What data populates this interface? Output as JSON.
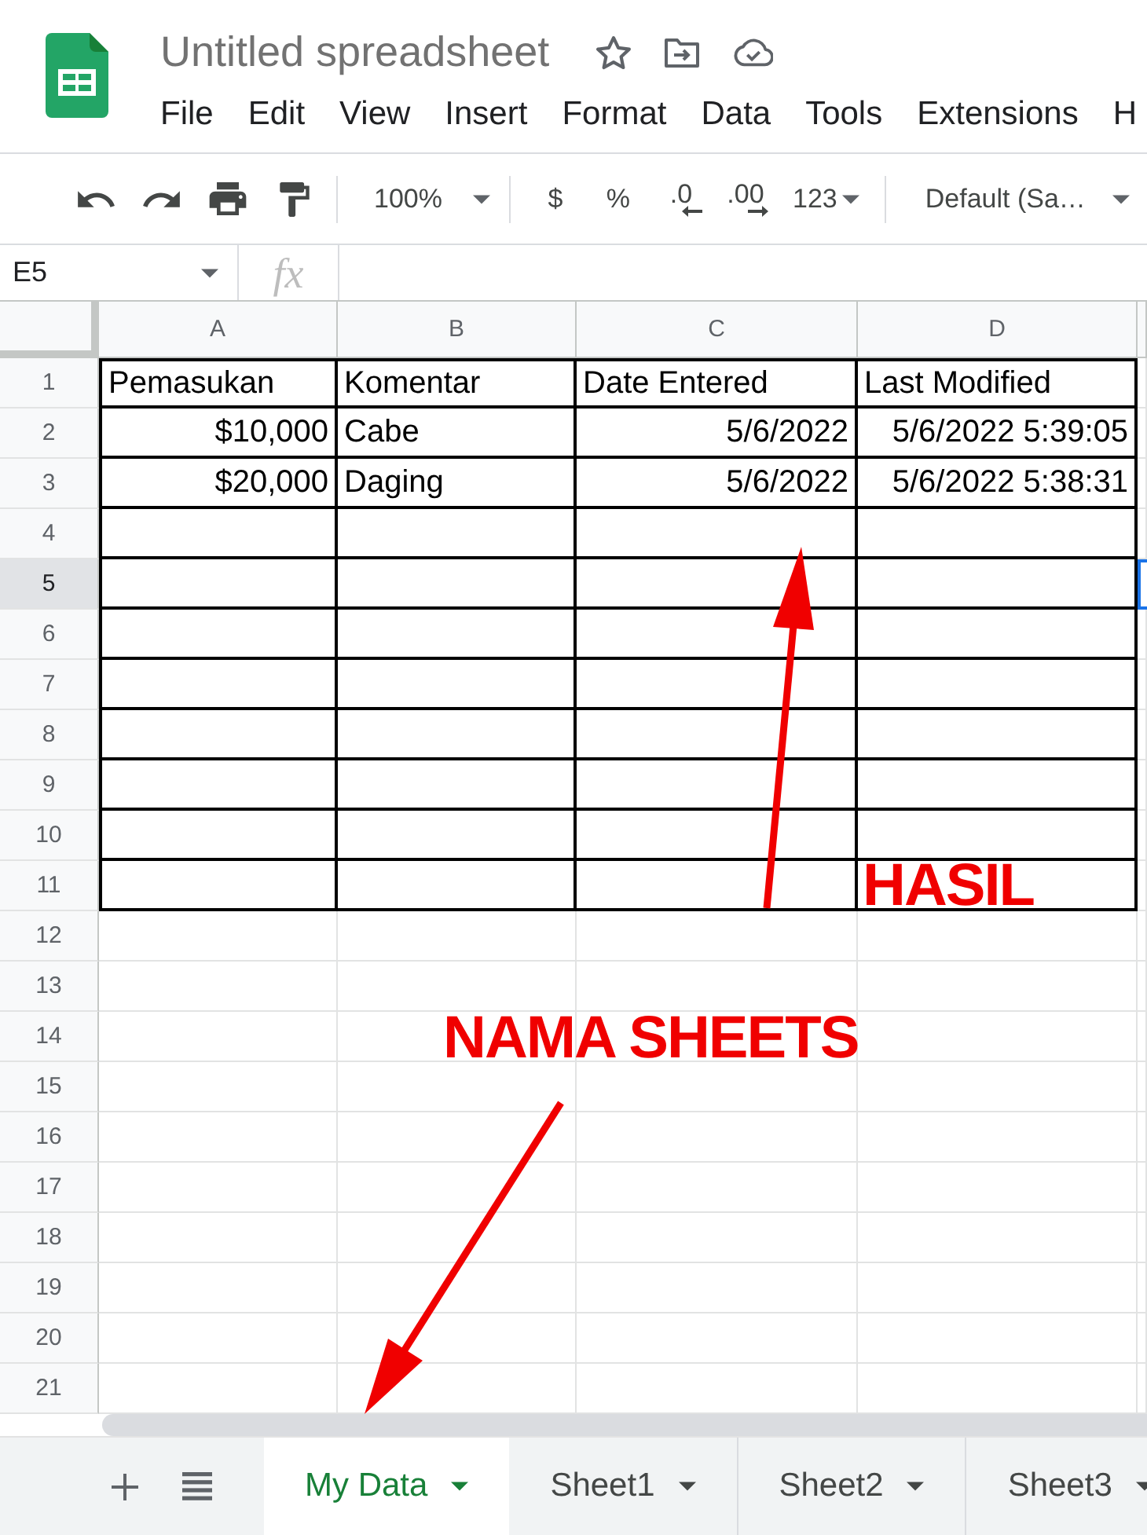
{
  "app": {
    "title": "Untitled spreadsheet",
    "menu": [
      "File",
      "Edit",
      "View",
      "Insert",
      "Format",
      "Data",
      "Tools",
      "Extensions",
      "H"
    ]
  },
  "toolbar": {
    "zoom": "100%",
    "currency": "$",
    "percent": "%",
    "decrease_decimal": ".0",
    "increase_decimal": ".00",
    "number_format": "123",
    "font": "Default (Sa…"
  },
  "formula_bar": {
    "cell_reference": "E5",
    "function_label": "fx"
  },
  "sheet": {
    "columns": [
      "A",
      "B",
      "C",
      "D"
    ],
    "rows": [
      {
        "label": "1",
        "bordered": true,
        "selected": false,
        "cells": [
          {
            "text": "Pemasukan",
            "kind": "text"
          },
          {
            "text": "Komentar",
            "kind": "text"
          },
          {
            "text": "Date Entered",
            "kind": "text"
          },
          {
            "text": "Last Modified",
            "kind": "text"
          }
        ]
      },
      {
        "label": "2",
        "bordered": true,
        "selected": false,
        "cells": [
          {
            "text": "$10,000",
            "kind": "number"
          },
          {
            "text": "Cabe",
            "kind": "text"
          },
          {
            "text": "5/6/2022",
            "kind": "number"
          },
          {
            "text": "5/6/2022 5:39:05",
            "kind": "number"
          }
        ]
      },
      {
        "label": "3",
        "bordered": true,
        "selected": false,
        "cells": [
          {
            "text": "$20,000",
            "kind": "number"
          },
          {
            "text": "Daging",
            "kind": "text"
          },
          {
            "text": "5/6/2022",
            "kind": "number"
          },
          {
            "text": "5/6/2022 5:38:31",
            "kind": "number"
          }
        ]
      },
      {
        "label": "4",
        "bordered": true,
        "selected": false
      },
      {
        "label": "5",
        "bordered": true,
        "selected": true
      },
      {
        "label": "6",
        "bordered": true,
        "selected": false
      },
      {
        "label": "7",
        "bordered": true,
        "selected": false
      },
      {
        "label": "8",
        "bordered": true,
        "selected": false
      },
      {
        "label": "9",
        "bordered": true,
        "selected": false
      },
      {
        "label": "10",
        "bordered": true,
        "selected": false
      },
      {
        "label": "11",
        "bordered": true,
        "selected": false
      },
      {
        "label": "12",
        "bordered": false,
        "selected": false
      },
      {
        "label": "13",
        "bordered": false,
        "selected": false
      },
      {
        "label": "14",
        "bordered": false,
        "selected": false
      },
      {
        "label": "15",
        "bordered": false,
        "selected": false
      },
      {
        "label": "16",
        "bordered": false,
        "selected": false
      },
      {
        "label": "17",
        "bordered": false,
        "selected": false
      },
      {
        "label": "18",
        "bordered": false,
        "selected": false
      },
      {
        "label": "19",
        "bordered": false,
        "selected": false
      },
      {
        "label": "20",
        "bordered": false,
        "selected": false
      },
      {
        "label": "21",
        "bordered": false,
        "selected": false
      }
    ]
  },
  "sheet_tabs": [
    {
      "label": "My Data",
      "selected": true
    },
    {
      "label": "Sheet1",
      "selected": false
    },
    {
      "label": "Sheet2",
      "selected": false
    },
    {
      "label": "Sheet3",
      "selected": false
    }
  ],
  "annotations": [
    {
      "text": "HASIL"
    },
    {
      "text": "NAMA SHEETS"
    }
  ]
}
